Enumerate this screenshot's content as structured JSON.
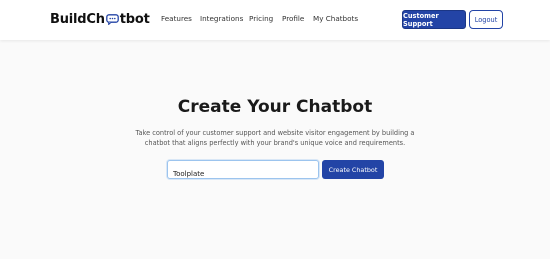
{
  "brand": {
    "logo_left": "BuildCh",
    "logo_right": "tbot",
    "accent_color": "#2344a6"
  },
  "nav": {
    "items": [
      {
        "label": "Features"
      },
      {
        "label": "Integrations"
      },
      {
        "label": "Pricing"
      },
      {
        "label": "Profile"
      },
      {
        "label": "My Chatbots"
      }
    ],
    "support_label": "Customer Support",
    "logout_label": "Logout"
  },
  "hero": {
    "title": "Create Your Chatbot",
    "description_line1": "Take control of your customer support and website visitor engagement by building a",
    "description_line2": "chatbot that aligns perfectly with your brand's unique voice and requirements.",
    "input_value": "Toolplate",
    "create_label": "Create Chatbot"
  }
}
